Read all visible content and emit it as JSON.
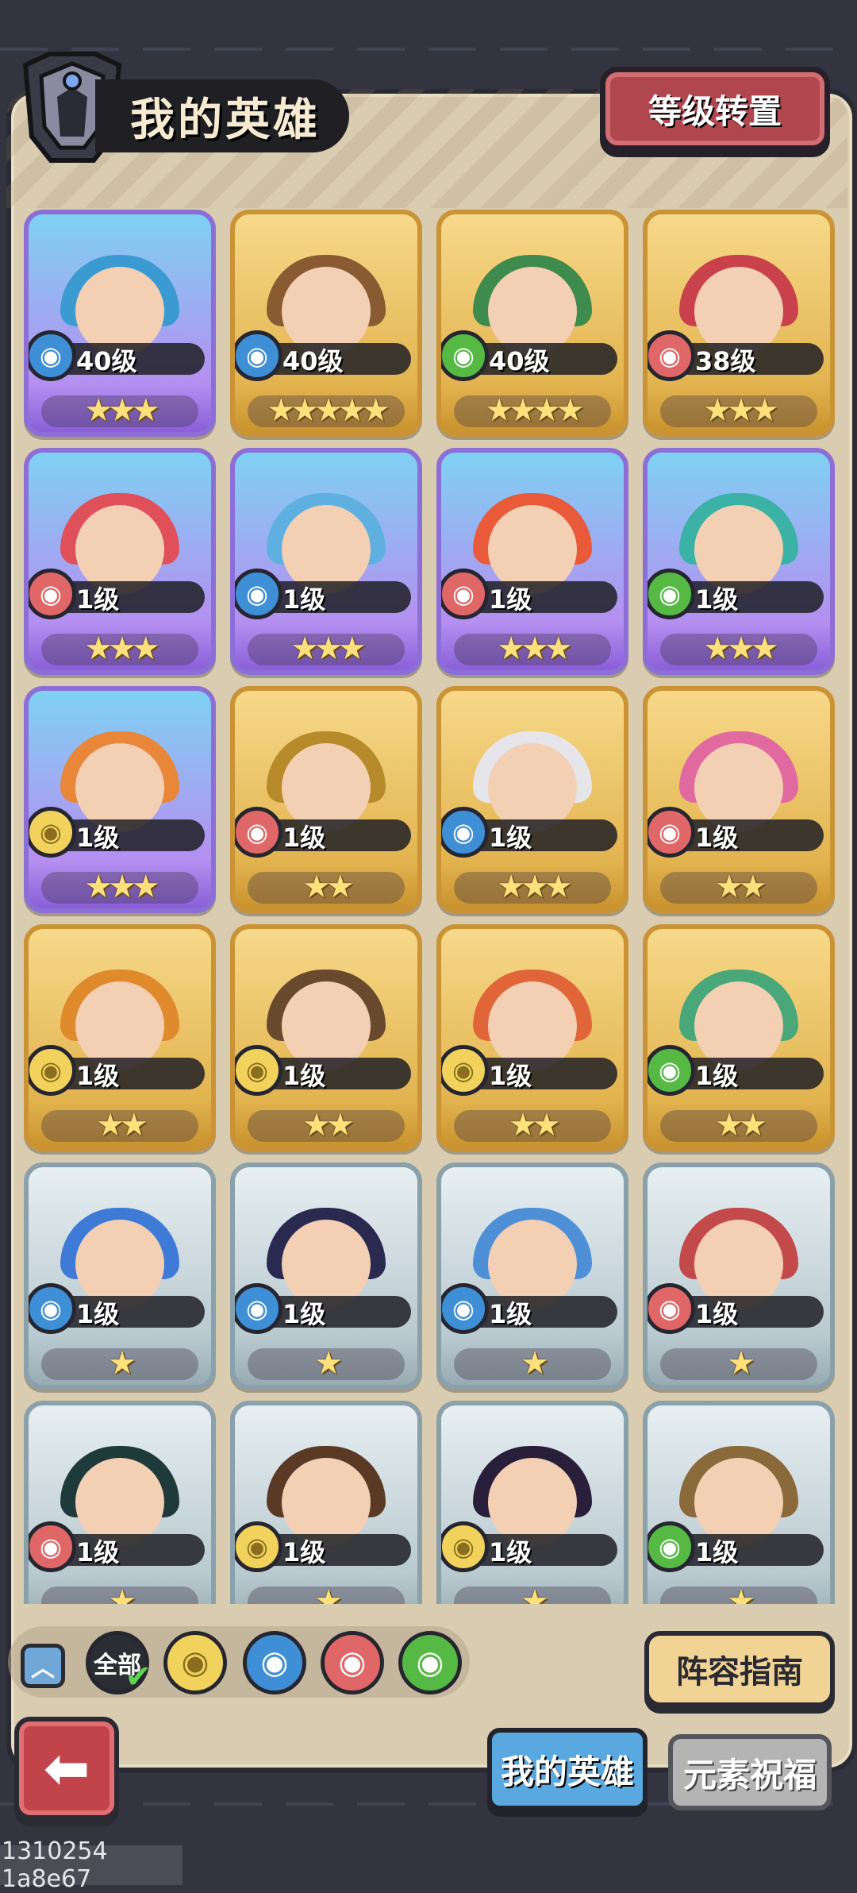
{
  "header": {
    "title": "我的英雄",
    "level_transfer_label": "等级转置"
  },
  "colors": {
    "water": "#3f8fd6",
    "fire": "#e06767",
    "wind": "#55b944",
    "earth": "#f0d25c",
    "purple_quality": "#b58ff0",
    "gold_quality": "#e2b450",
    "blue_quality": "#b9c9d0"
  },
  "heroes": [
    {
      "element": "water",
      "level": "40级",
      "stars": 3,
      "quality": "purple"
    },
    {
      "element": "water",
      "level": "40级",
      "stars": 5,
      "quality": "gold"
    },
    {
      "element": "wind",
      "level": "40级",
      "stars": 4,
      "quality": "gold"
    },
    {
      "element": "fire",
      "level": "38级",
      "stars": 3,
      "quality": "gold"
    },
    {
      "element": "fire",
      "level": "1级",
      "stars": 3,
      "quality": "purple"
    },
    {
      "element": "water",
      "level": "1级",
      "stars": 3,
      "quality": "purple"
    },
    {
      "element": "fire",
      "level": "1级",
      "stars": 3,
      "quality": "purple"
    },
    {
      "element": "wind",
      "level": "1级",
      "stars": 3,
      "quality": "purple"
    },
    {
      "element": "earth",
      "level": "1级",
      "stars": 3,
      "quality": "purple"
    },
    {
      "element": "fire",
      "level": "1级",
      "stars": 2,
      "quality": "gold"
    },
    {
      "element": "water",
      "level": "1级",
      "stars": 3,
      "quality": "gold"
    },
    {
      "element": "fire",
      "level": "1级",
      "stars": 2,
      "quality": "gold"
    },
    {
      "element": "earth",
      "level": "1级",
      "stars": 2,
      "quality": "gold"
    },
    {
      "element": "earth",
      "level": "1级",
      "stars": 2,
      "quality": "gold"
    },
    {
      "element": "earth",
      "level": "1级",
      "stars": 2,
      "quality": "gold"
    },
    {
      "element": "wind",
      "level": "1级",
      "stars": 2,
      "quality": "gold"
    },
    {
      "element": "water",
      "level": "1级",
      "stars": 1,
      "quality": "blue"
    },
    {
      "element": "water",
      "level": "1级",
      "stars": 1,
      "quality": "blue"
    },
    {
      "element": "water",
      "level": "1级",
      "stars": 1,
      "quality": "blue"
    },
    {
      "element": "fire",
      "level": "1级",
      "stars": 1,
      "quality": "blue"
    },
    {
      "element": "fire",
      "level": "1级",
      "stars": 1,
      "quality": "blue"
    },
    {
      "element": "earth",
      "level": "1级",
      "stars": 1,
      "quality": "blue"
    },
    {
      "element": "earth",
      "level": "1级",
      "stars": 1,
      "quality": "blue"
    },
    {
      "element": "wind",
      "level": "1级",
      "stars": 1,
      "quality": "blue"
    }
  ],
  "filters": {
    "all_label": "全部"
  },
  "buttons": {
    "lineup_guide": "阵容指南"
  },
  "tabs": {
    "my_heroes": "我的英雄",
    "element_blessing": "元素祝福"
  },
  "footer": {
    "id_text": "1310254 1a8e67"
  }
}
